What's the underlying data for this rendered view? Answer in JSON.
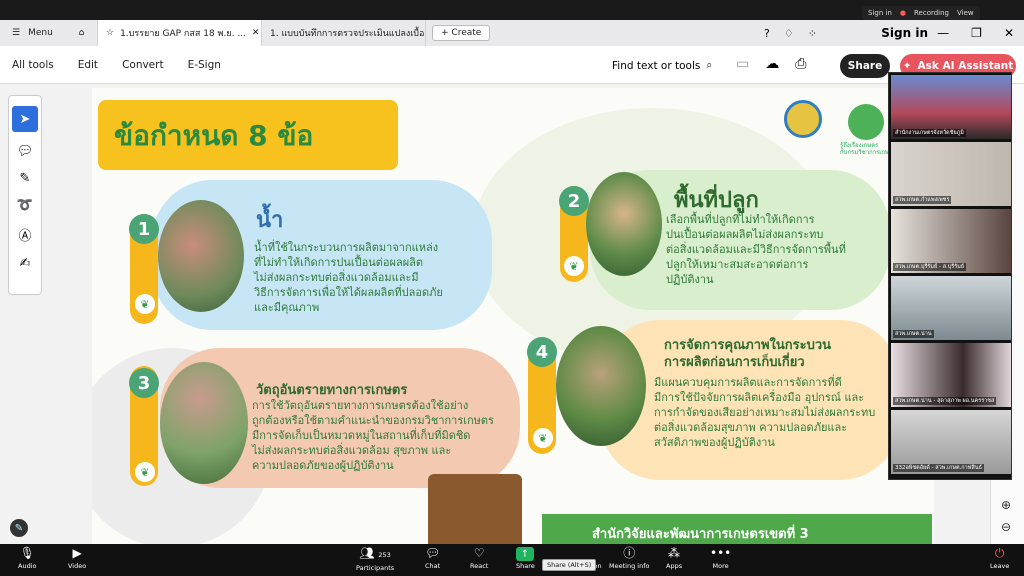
{
  "zoom_topbar": {
    "signin": "Sign in",
    "recording": "Recording",
    "view": "View"
  },
  "tabs": {
    "menu": "Menu",
    "active": "1.บรรยาย GAP กสส 18 พ.ย. ...",
    "second": "1. แบบบันทึกการตรวจประเมินแปลงเบื้อง...",
    "create": "Create",
    "signin": "Sign in"
  },
  "toolbar": {
    "all_tools": "All tools",
    "edit": "Edit",
    "convert": "Convert",
    "esign": "E-Sign",
    "find": "Find text or tools",
    "share": "Share",
    "ai": "Ask AI Assistant"
  },
  "slide": {
    "title": "ข้อกำหนด 8 ข้อ",
    "items": [
      {
        "num": "1",
        "heading": "น้ำ",
        "text": "น้ำที่ใช้ในกระบวนการผลิตมาจากแหล่ง\nที่ไม่ทำให้เกิดการปนเปื้อนต่อผลผลิต\nไม่ส่งผลกระทบต่อสิ่งแวดล้อมและมี\nวิธีการจัดการเพื่อให้ได้ผลผลิตที่ปลอดภัย\nและมีคุณภาพ"
      },
      {
        "num": "2",
        "heading": "พื้นที่ปลูก",
        "text": "เลือกพื้นที่ปลูกที่ไม่ทำให้เกิดการ\nปนเปื้อนต่อผลผลิตไม่ส่งผลกระทบ\nต่อสิ่งแวดล้อมและมีวิธีการจัดการพื้นที่\nปลูกให้เหมาะสมสะอาดต่อการ\nปฏิบัติงาน"
      },
      {
        "num": "3",
        "heading": "วัตถุอันตรายทางการเกษตร",
        "text": "การใช้วัตถุอันตรายทางการเกษตรต้องใช้อย่าง\nถูกต้องหรือใช้ตามคำแนะนำของกรมวิชาการเกษตร\nมีการจัดเก็บเป็นหมวดหมู่ในสถานที่เก็บที่มิดชิด\nไม่ส่งผลกระทบต่อสิ่งแวดล้อม สุขภาพ และ\nความปลอดภัยของผู้ปฏิบัติงาน"
      },
      {
        "num": "4",
        "heading": "การจัดการคุณภาพในกระบวน\nการผลิตก่อนการเก็บเกี่ยว",
        "text": "มีแผนควบคุมการผลิตและการจัดการที่ดี\nมีการใช้ปัจจัยการผลิตเครื่องมือ อุปกรณ์ และ\nการกำจัดของเสียอย่างเหมาะสมไม่ส่งผลกระทบ\nต่อสิ่งแวดล้อมสุขภาพ ความปลอดภัยและ\nสวัสดิภาพของผู้ปฏิบัติงาน"
      }
    ],
    "footer": "สำนักวิจัยและพัฒนาการเกษตรเขตที่ 3",
    "logo_text": "รู้ถึงเรื่องเกษตร\nกับกรมวิชาการเกษตร"
  },
  "participants": [
    "สำนักงานเกษตรจังหวัดชัยภูมิ",
    "สวพ.เกษต.กำแพงเพชร",
    "สวพ.เกษต.บุรีรัมย์ - ส.บุรีรัมย์",
    "สวพ.เกษต.น่าน",
    "สวพ.เกษต.น่าน - สุดาสุภาพ ผอ.นครราชส",
    "332อพิชตอัยด์ - สวพ.เกษต.กาฬสินธ์"
  ],
  "zoom_footer": {
    "audio": "Audio",
    "video": "Video",
    "participants": "Participants",
    "participant_count": "253",
    "chat": "Chat",
    "react": "React",
    "share": "Share",
    "share_tooltip": "Share (Alt+S)",
    "annotation": "Annotation",
    "meeting_info": "Meeting info",
    "apps": "Apps",
    "more": "More",
    "leave": "Leave"
  },
  "colors": {
    "accent_green": "#4aa476",
    "title_yellow": "#f7c11e",
    "footer_green": "#4fa84a",
    "ai_red": "#e8555f"
  }
}
